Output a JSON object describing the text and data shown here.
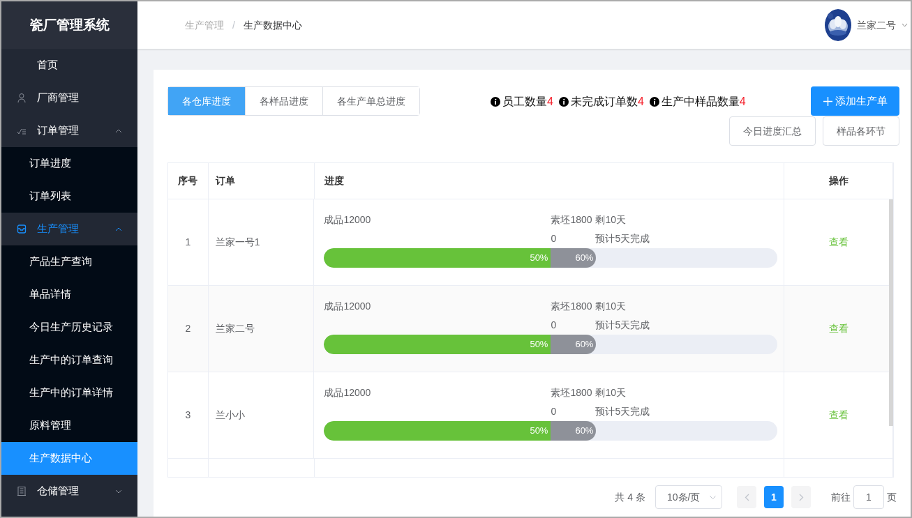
{
  "app_title": "瓷厂管理系统",
  "sidebar": {
    "items": [
      {
        "label": "首页",
        "selected": false
      },
      {
        "label": "厂商管理",
        "selected": false
      },
      {
        "label": "订单管理",
        "expanded": true,
        "selected": false,
        "children": [
          {
            "label": "订单进度",
            "selected": false
          },
          {
            "label": "订单列表",
            "selected": false
          }
        ]
      },
      {
        "label": "生产管理",
        "expanded": true,
        "selected": true,
        "children": [
          {
            "label": "产品生产查询",
            "selected": false
          },
          {
            "label": "单品详情",
            "selected": false
          },
          {
            "label": "今日生产历史记录",
            "selected": false
          },
          {
            "label": "生产中的订单查询",
            "selected": false
          },
          {
            "label": "生产中的订单详情",
            "selected": false
          },
          {
            "label": "原料管理",
            "selected": false
          },
          {
            "label": "生产数据中心",
            "selected": true
          }
        ]
      },
      {
        "label": "仓储管理",
        "expanded": false,
        "selected": false
      }
    ]
  },
  "breadcrumb": {
    "items": [
      "生产管理",
      "生产数据中心"
    ],
    "separator": "/"
  },
  "user": {
    "name": "兰家二号"
  },
  "tabs": [
    {
      "label": "各仓库进度",
      "selected": true
    },
    {
      "label": "各样品进度",
      "selected": false
    },
    {
      "label": "各生产单总进度",
      "selected": false
    }
  ],
  "stats": [
    {
      "label": "员工数量",
      "count": "4"
    },
    {
      "label": "未完成订单数",
      "count": "4"
    },
    {
      "label": "生产中样品数量",
      "count": "4"
    }
  ],
  "add_button": "添加生产单",
  "buttons": [
    "今日进度汇总",
    "样品各环节"
  ],
  "table": {
    "columns": [
      "序号",
      "订单",
      "进度",
      "操作"
    ],
    "rows": [
      {
        "index": "1",
        "order": "兰家一号1",
        "product": "成品12000",
        "blank": "素坯18000",
        "remaining": "剩10天",
        "eta": "预计5天完成",
        "done": {
          "level": 0.5,
          "label": "50%"
        },
        "blank_progress": {
          "level": 0.6,
          "label": "60%"
        },
        "action": "查看"
      },
      {
        "index": "2",
        "order": "兰家二号",
        "product": "成品12000",
        "blank": "素坯18000",
        "remaining": "剩10天",
        "eta": "预计5天完成",
        "done": {
          "level": 0.5,
          "label": "50%"
        },
        "blank_progress": {
          "level": 0.6,
          "label": "60%"
        },
        "action": "查看"
      },
      {
        "index": "3",
        "order": "兰小小",
        "product": "成品12000",
        "blank": "素坯18000",
        "remaining": "剩10天",
        "eta": "预计5天完成",
        "done": {
          "level": 0.5,
          "label": "50%"
        },
        "blank_progress": {
          "level": 0.6,
          "label": "60%"
        },
        "action": "查看"
      }
    ]
  },
  "pagination": {
    "total": "共 4 条",
    "page_size": "10条/页",
    "pages": [
      {
        "label": "1",
        "selected": true
      }
    ],
    "goto_label": "前往",
    "goto_value": "1",
    "goto_suffix": "页"
  }
}
